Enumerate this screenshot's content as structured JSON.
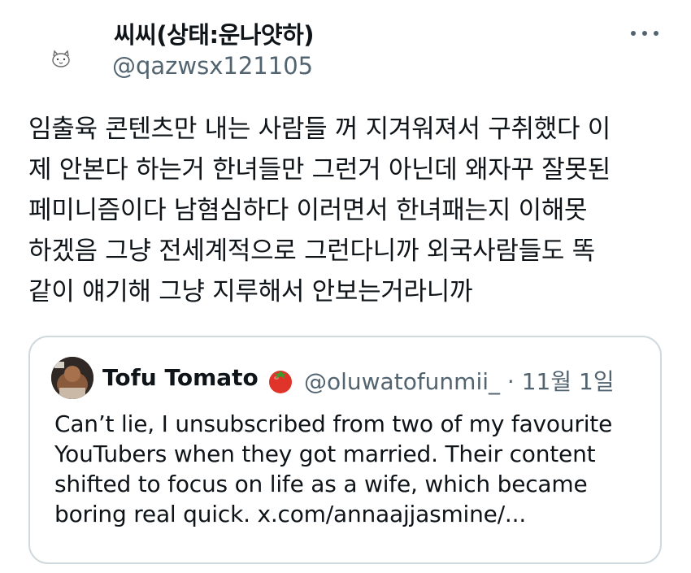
{
  "author": {
    "display_name": "씨씨(상태:운나얏하)",
    "handle": "@qazwsx121105",
    "avatar_icon": "cartoon-cat-avatar-icon"
  },
  "more_icon": "more-horizontal-icon",
  "tweet": {
    "lines": [
      "임출육 콘텐츠만 내는 사람들 꺼 지겨워져서 구취했다 이",
      "제 안본다 하는거 한녀들만 그런거 아닌데 왜자꾸 잘못된",
      "페미니즘이다 남혐심하다 이러면서 한녀패는지 이해못",
      "하겠음 그냥 전세계적으로 그런다니까 외국사람들도 똑",
      "같이 얘기해 그냥 지루해서 안보는거라니까"
    ]
  },
  "quote": {
    "display_name": "Tofu Tomato",
    "emoji_icon": "tomato-icon",
    "handle_and_date": "@oluwatofunmii_ · 11월 1일",
    "lines": [
      "Can’t lie, I unsubscribed from two of my favourite",
      "YouTubers when they got married. Their content",
      "shifted to focus on life as a wife, which became",
      "boring real quick. x.com/annaajjasmine/..."
    ]
  },
  "colors": {
    "text": "#0f1419",
    "secondary": "#536471",
    "border": "#cfd9de",
    "background": "#ffffff"
  }
}
